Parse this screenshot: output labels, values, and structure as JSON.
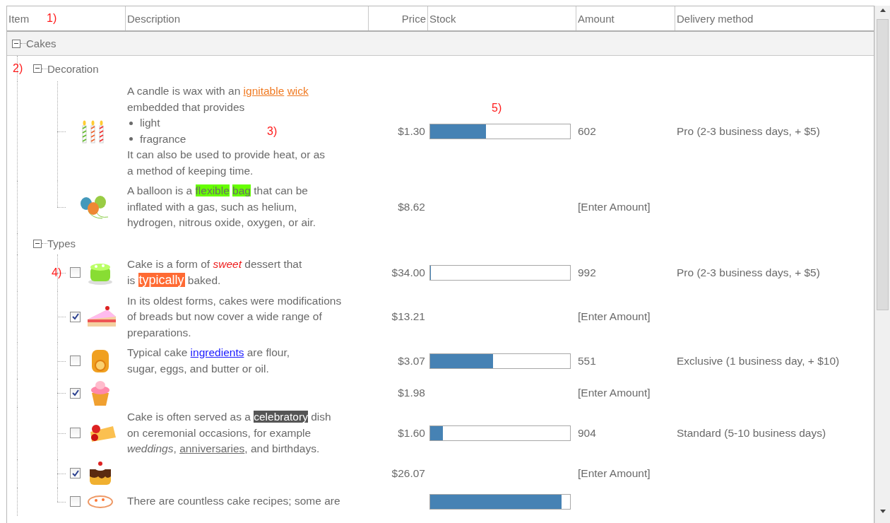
{
  "columns": [
    {
      "label": "Item",
      "note": "1)"
    },
    {
      "label": "Description"
    },
    {
      "label": "Price"
    },
    {
      "label": "Stock"
    },
    {
      "label": "Amount"
    },
    {
      "label": "Delivery method"
    }
  ],
  "groups": [
    {
      "label": "Cakes",
      "expanded": true,
      "children": [
        {
          "label": "Decoration",
          "expanded": true,
          "note": "2)",
          "items": [
            {
              "description": [
                {
                  "kind": "text",
                  "segments": [
                    {
                      "text": "A candle is wax with an "
                    },
                    {
                      "text": "ignitable",
                      "kind": "link",
                      "color": "#f07a22"
                    },
                    {
                      "text": "wick",
                      "kind": "link",
                      "color": "#f07a22"
                    },
                    {
                      "text": "\nembedded that provides"
                    }
                  ]
                },
                {
                  "kind": "bullet",
                  "text": "light"
                },
                {
                  "kind": "bullet",
                  "text": "fragrance"
                },
                {
                  "kind": "text",
                  "segments": [
                    {
                      "text": "It can also be used to provide heat, or as\na method of keeping time."
                    }
                  ]
                }
              ],
              "description_note": "3)",
              "price": "$1.30",
              "stock": {
                "level": 0.4,
                "note": "5)"
              },
              "amount": "602",
              "delivery": "Pro (2-3 business days, + $5)"
            },
            {
              "description": [
                {
                  "kind": "text",
                  "segments": [
                    {
                      "text": "A balloon is a "
                    },
                    {
                      "text": "flexible",
                      "kind": "highlight",
                      "color": "#66ff00"
                    },
                    {
                      "text": "bag",
                      "kind": "highlight",
                      "color": "#66ff00"
                    },
                    {
                      "text": " that can be\ninflated with a gas, such as helium,\nhydrogen, nitrous oxide, oxygen, or air."
                    }
                  ]
                }
              ],
              "price": "$8.62",
              "amount": "[Enter Amount]"
            }
          ]
        },
        {
          "label": "Types",
          "expanded": true,
          "items": [
            {
              "checked": false,
              "note": "4)",
              "description": [
                {
                  "kind": "text",
                  "segments": [
                    {
                      "text": "Cake is a form of "
                    },
                    {
                      "text": "sweet",
                      "kind": "italic",
                      "color": "#ee1c1c"
                    },
                    {
                      "text": " dessert that\nis "
                    },
                    {
                      "text": "typically",
                      "kind": "highlight_large",
                      "color": "#ff6a33"
                    },
                    {
                      "text": " baked."
                    }
                  ]
                }
              ],
              "price": "$34.00",
              "stock": {
                "level": 0
              },
              "amount": "992",
              "delivery": "Pro (2-3 business days, + $5)"
            },
            {
              "checked": true,
              "description": [
                {
                  "kind": "text",
                  "segments": [
                    {
                      "text": "In its oldest forms, cakes were modifications\nof breads but now cover a wide range of\npreparations."
                    }
                  ]
                }
              ],
              "price": "$13.21",
              "amount": "[Enter Amount]"
            },
            {
              "checked": false,
              "description": [
                {
                  "kind": "text",
                  "segments": [
                    {
                      "text": "Typical cake "
                    },
                    {
                      "text": "ingredients",
                      "kind": "link",
                      "color": "#1a1aff"
                    },
                    {
                      "text": " are flour,\nsugar, eggs, and butter or oil."
                    }
                  ]
                }
              ],
              "price": "$3.07",
              "stock": {
                "level": 0.45
              },
              "amount": "551",
              "delivery": "Exclusive (1 business day, + $10)"
            },
            {
              "checked": true,
              "price": "$1.98",
              "amount": "[Enter Amount]"
            },
            {
              "checked": false,
              "description": [
                {
                  "kind": "text",
                  "segments": [
                    {
                      "text": "Cake is often served as a "
                    },
                    {
                      "text": "celebratory",
                      "kind": "highlight",
                      "color": "#555555"
                    },
                    {
                      "text": " dish\non ceremonial occasions, for example\n"
                    },
                    {
                      "text": "weddings",
                      "kind": "italic"
                    },
                    {
                      "text": ", "
                    },
                    {
                      "text": "anniversaries",
                      "kind": "underline"
                    },
                    {
                      "text": ", and birthdays."
                    }
                  ]
                }
              ],
              "price": "$1.60",
              "stock": {
                "level": 0.09
              },
              "amount": "904",
              "delivery": "Standard (5-10 business days)"
            },
            {
              "checked": true,
              "price": "$26.07",
              "amount": "[Enter Amount]"
            },
            {
              "checked": false,
              "description": [
                {
                  "kind": "text",
                  "segments": [
                    {
                      "text": "There are countless cake recipes; some are"
                    }
                  ]
                }
              ],
              "stock": {
                "level": 0.94
              }
            }
          ]
        }
      ]
    }
  ]
}
